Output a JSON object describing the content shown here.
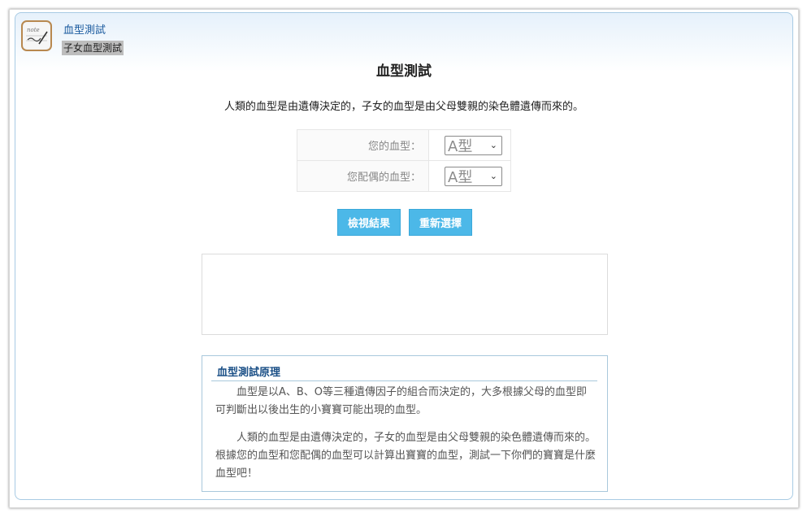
{
  "app": {
    "title": "血型測試",
    "subtitle": "子女血型測試",
    "icon": "notepad-icon"
  },
  "main": {
    "title": "血型測試",
    "intro": "人類的血型是由遺傳決定的，子女的血型是由父母雙親的染色體遺傳而來的。"
  },
  "form": {
    "your_label": "您的血型：",
    "your_value": "A型",
    "spouse_label": "您配偶的血型：",
    "spouse_value": "A型"
  },
  "buttons": {
    "view": "檢視結果",
    "reset": "重新選擇"
  },
  "principle": {
    "title": "血型測試原理",
    "para1": "血型是以A、B、O等三種遺傳因子的組合而決定的，大多根據父母的血型即可判斷出以後出生的小寶寶可能出現的血型。",
    "para2": "人類的血型是由遺傳決定的，子女的血型是由父母雙親的染色體遺傳而來的。根據您的血型和您配偶的血型可以計算出寶寶的血型，測試一下你們的寶寶是什麼血型吧！"
  },
  "colors": {
    "button": "#4cb8e8",
    "title_link": "#1a5a9e",
    "border_accent": "#a9c8dc"
  }
}
